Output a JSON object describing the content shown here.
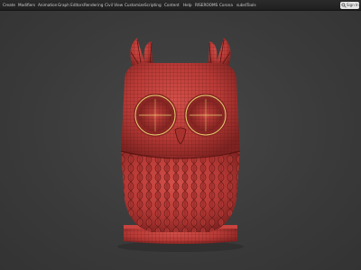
{
  "menu": {
    "items": [
      {
        "label": "Create"
      },
      {
        "label": "Modifiers"
      },
      {
        "label": "Animation"
      },
      {
        "label": "Graph Editors"
      },
      {
        "label": "Rendering"
      },
      {
        "label": "Civil View"
      },
      {
        "label": "Customize"
      },
      {
        "label": "Scripting"
      },
      {
        "label": "Content"
      },
      {
        "label": "Help"
      },
      {
        "label": "RISEROOMS"
      },
      {
        "label": "Corona"
      },
      {
        "label": "substTools"
      }
    ],
    "search_label": "Sign In"
  },
  "icons": {
    "search": "search-icon"
  },
  "colors": {
    "menubar": "#252525",
    "viewport": "#3c3c3c",
    "model": "#b83a36",
    "wireframe": "#5a1412",
    "eye_ring": "#e8d070"
  }
}
